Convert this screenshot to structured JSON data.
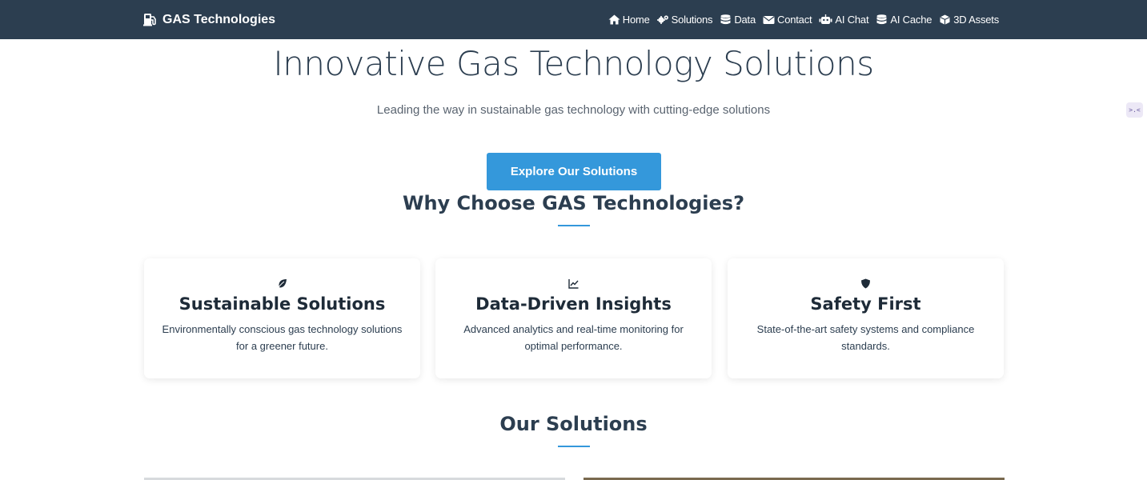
{
  "brand": {
    "name": "GAS Technologies",
    "icon": "gas-pump-icon"
  },
  "nav": {
    "items": [
      {
        "label": "Home",
        "icon": "home-icon"
      },
      {
        "label": "Solutions",
        "icon": "gears-icon"
      },
      {
        "label": "Data",
        "icon": "database-icon"
      },
      {
        "label": "Contact",
        "icon": "envelope-icon"
      },
      {
        "label": "AI Chat",
        "icon": "robot-icon"
      },
      {
        "label": "AI Cache",
        "icon": "database-icon"
      },
      {
        "label": "3D Assets",
        "icon": "cube-icon"
      }
    ]
  },
  "hero": {
    "title": "Innovative Gas Technology Solutions",
    "subtitle": "Leading the way in sustainable gas technology with cutting-edge solutions",
    "cta_label": "Explore Our Solutions"
  },
  "why": {
    "title": "Why Choose GAS Technologies?",
    "cards": [
      {
        "title": "Sustainable Solutions",
        "desc": "Environmentally conscious gas technology solutions for a greener future.",
        "icon": "leaf-icon"
      },
      {
        "title": "Data-Driven Insights",
        "desc": "Advanced analytics and real-time monitoring for optimal performance.",
        "icon": "chart-line-icon"
      },
      {
        "title": "Safety First",
        "desc": "State-of-the-art safety systems and compliance standards.",
        "icon": "shield-icon"
      }
    ]
  },
  "solutions": {
    "title": "Our Solutions"
  },
  "colors": {
    "navbar": "#2c3e50",
    "accent": "#3498db",
    "text": "#2c3e50"
  }
}
